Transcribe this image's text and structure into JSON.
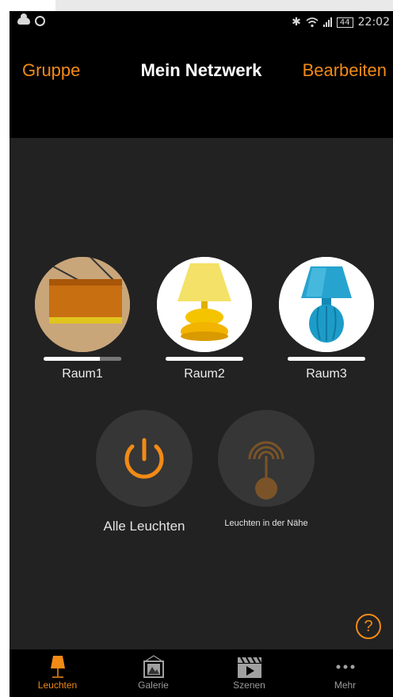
{
  "status_bar": {
    "time": "22:02",
    "battery": "44"
  },
  "nav": {
    "left_label": "Gruppe",
    "title": "Mein Netzwerk",
    "right_label": "Bearbeiten"
  },
  "rooms": [
    {
      "label": "Raum1",
      "brightness": 0.72
    },
    {
      "label": "Raum2",
      "brightness": 1.0
    },
    {
      "label": "Raum3",
      "brightness": 1.0
    }
  ],
  "actions": {
    "all_lights_label": "Alle Leuchten",
    "nearby_label": "Leuchten in der Nähe"
  },
  "help": {
    "symbol": "?"
  },
  "tabs": [
    {
      "label": "Leuchten",
      "icon": "lamp-icon",
      "active": true
    },
    {
      "label": "Galerie",
      "icon": "gallery-icon",
      "active": false
    },
    {
      "label": "Szenen",
      "icon": "clapperboard-icon",
      "active": false
    },
    {
      "label": "Mehr",
      "icon": "more-dots-icon",
      "active": false
    }
  ],
  "colors": {
    "accent": "#f28a16",
    "background": "#222222",
    "bars": "#000000"
  }
}
